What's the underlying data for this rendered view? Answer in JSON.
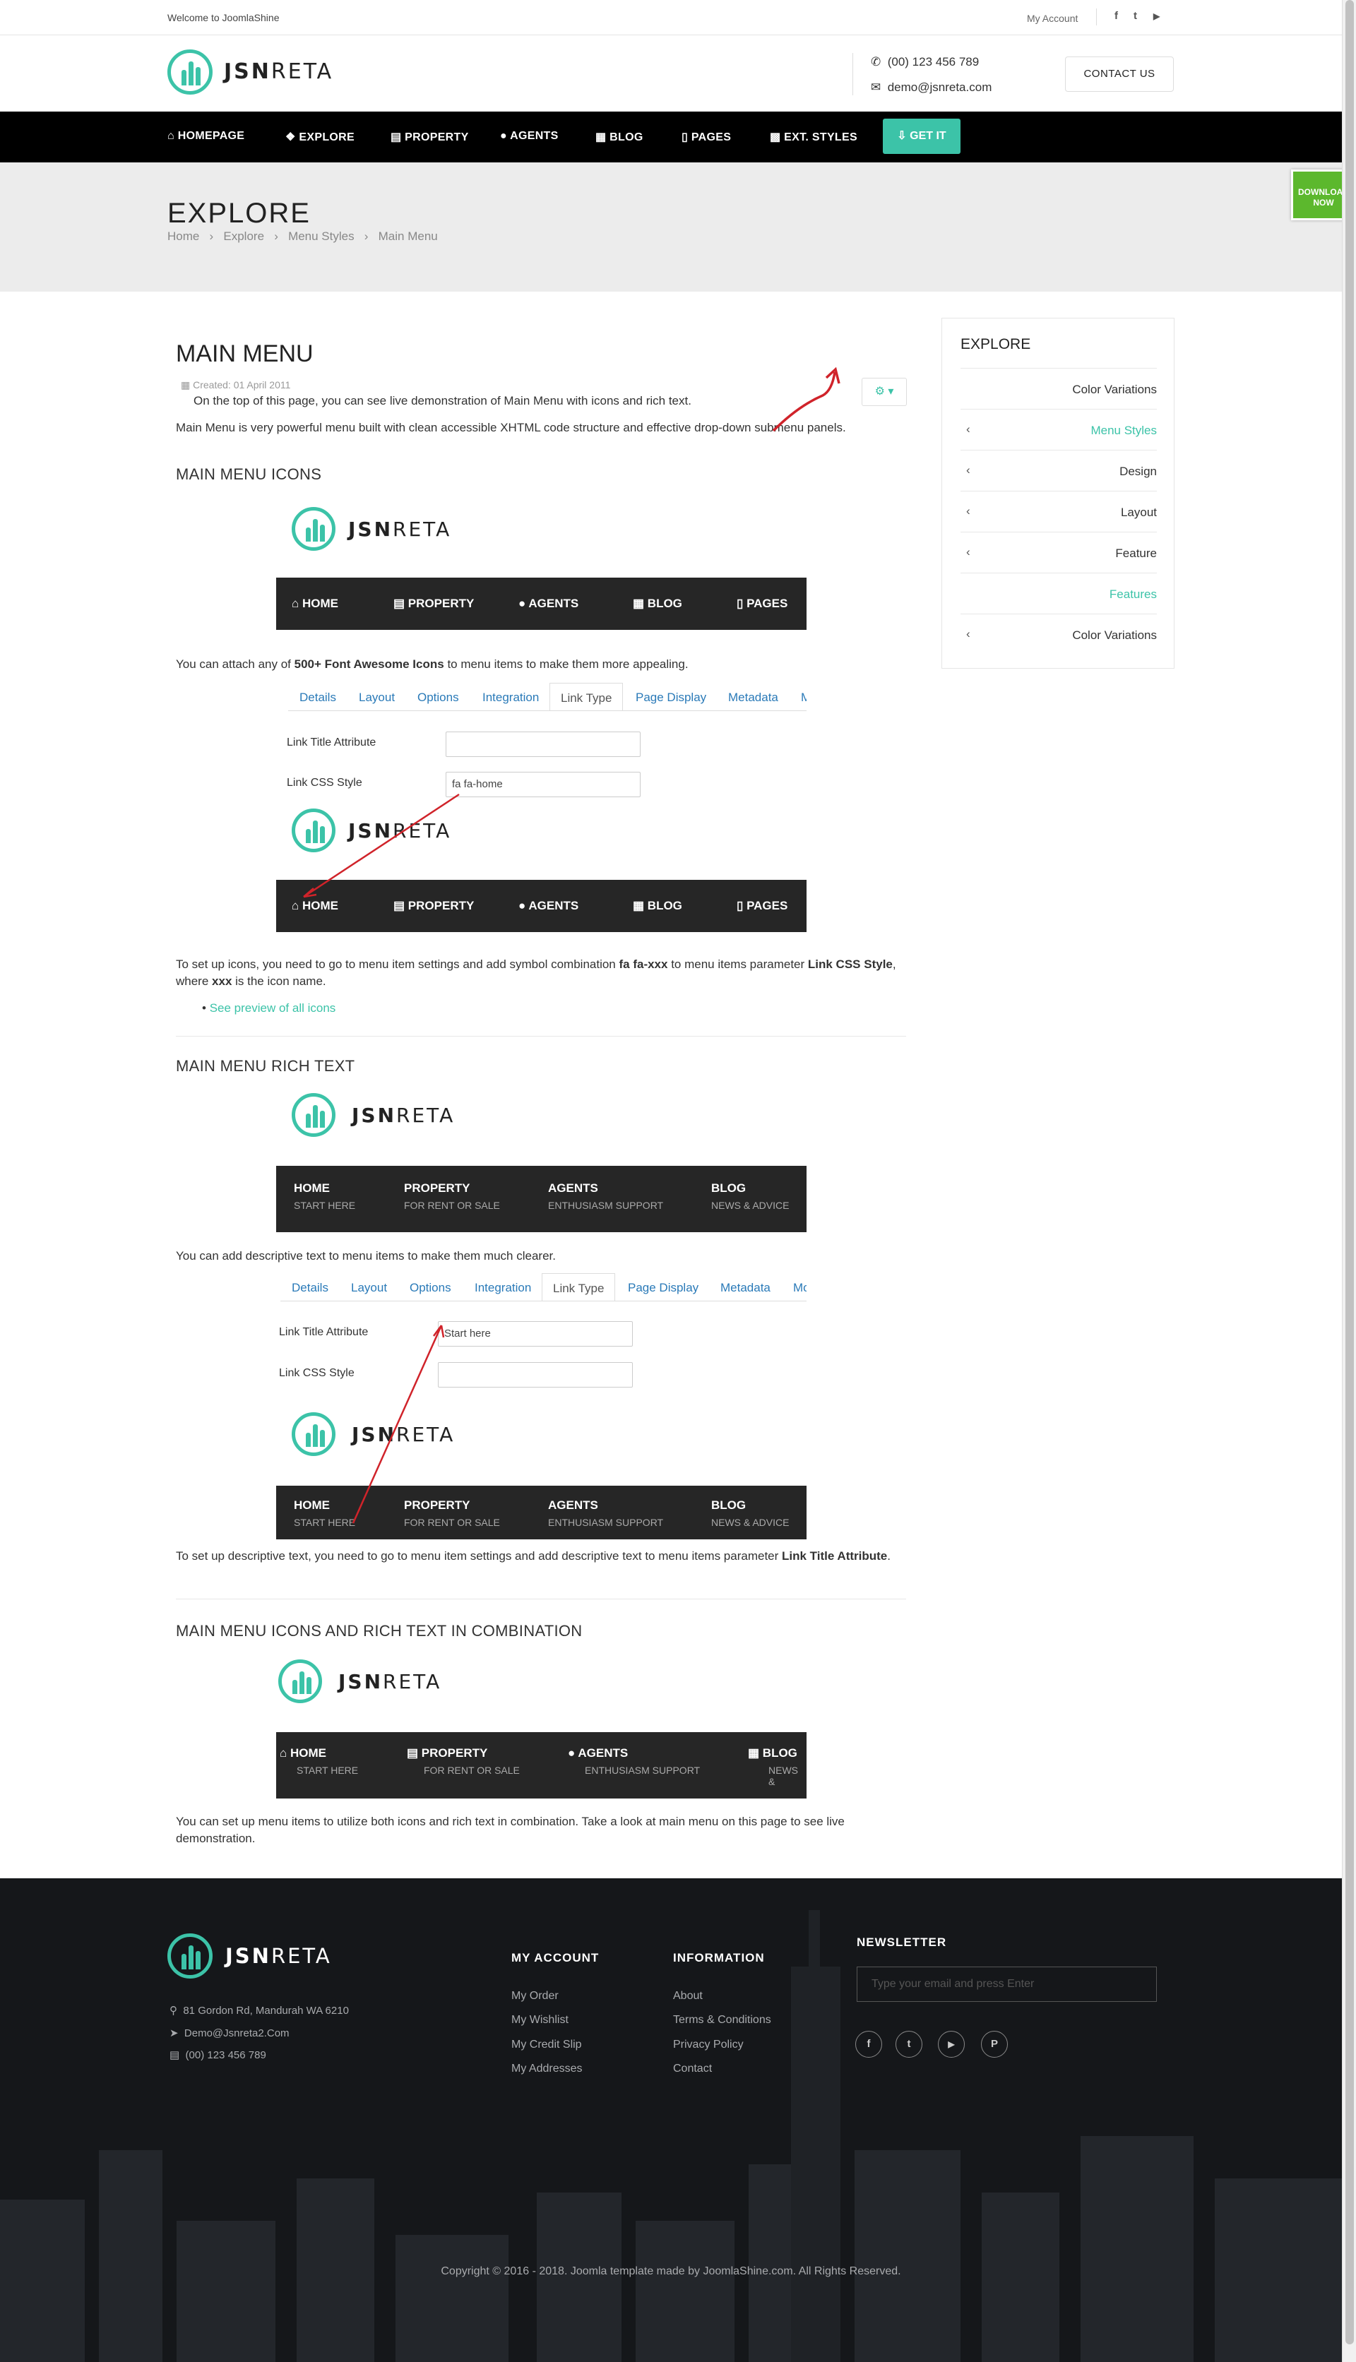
{
  "topbar": {
    "welcome": "Welcome to JoomlaShine",
    "my_account": "My Account",
    "social": [
      "f",
      "t",
      "▶"
    ]
  },
  "brand": {
    "bold": "JSN",
    "light": "RETA"
  },
  "header": {
    "phone": "(00) 123 456 789",
    "email": "demo@jsnreta.com",
    "contact_button": "CONTACT US"
  },
  "nav": {
    "items": [
      "HOMEPAGE",
      "EXPLORE",
      "PROPERTY",
      "AGENTS",
      "BLOG",
      "PAGES",
      "EXT. STYLES"
    ],
    "cta": "GET IT"
  },
  "download": {
    "line1": "DOWNLOAD",
    "line2": "NOW"
  },
  "banner": {
    "title": "EXPLORE",
    "breadcrumb": [
      "Home",
      "Explore",
      "Menu Styles",
      "Main Menu"
    ]
  },
  "article": {
    "title": "MAIN MENU",
    "created": "Created: 01 April 2011",
    "intro1": "On the top of this page, you can see live demonstration of Main Menu with icons and rich text.",
    "intro2": "Main Menu is very powerful menu built with clean accessible XHTML code structure and effective drop-down submenu panels.",
    "s1_title": "MAIN MENU ICONS",
    "s1_p1_a": "You can attach any of ",
    "s1_p1_b": "500+ Font Awesome Icons",
    "s1_p1_c": " to menu items to make them more appealing.",
    "s1_p2_a": "To set up icons, you need to go to menu item settings and add symbol combination ",
    "s1_p2_b": "fa fa-xxx",
    "s1_p2_c": " to menu items parameter ",
    "s1_p2_d": "Link CSS Style",
    "s1_p2_e": ", where ",
    "s1_p2_f": "xxx",
    "s1_p2_g": " is the icon name.",
    "s1_link": "See preview of all icons",
    "s2_title": "MAIN MENU RICH TEXT",
    "s2_p1": "You can add descriptive text to menu items to make them much clearer.",
    "s2_p2_a": "To set up descriptive text, you need to go to menu item settings and add descriptive text to menu items parameter ",
    "s2_p2_b": "Link Title Attribute",
    "s3_title": "MAIN MENU ICONS AND RICH TEXT IN COMBINATION",
    "s3_p1": "You can set up menu items to utilize both icons and rich text in combination. Take a look at main menu on this page to see live demonstration."
  },
  "demo_nav_icons": [
    "HOME",
    "PROPERTY",
    "AGENTS",
    "BLOG",
    "PAGES"
  ],
  "demo_nav_rich": [
    {
      "t": "HOME",
      "s": "START HERE"
    },
    {
      "t": "PROPERTY",
      "s": "FOR RENT OR SALE"
    },
    {
      "t": "AGENTS",
      "s": "ENTHUSIASM SUPPORT"
    },
    {
      "t": "BLOG",
      "s": "NEWS & ADVICE"
    }
  ],
  "demo_nav_combo": [
    {
      "t": "HOME",
      "s": "START HERE"
    },
    {
      "t": "PROPERTY",
      "s": "FOR RENT OR SALE"
    },
    {
      "t": "AGENTS",
      "s": "ENTHUSIASM SUPPORT"
    },
    {
      "t": "BLOG",
      "s": "NEWS &"
    }
  ],
  "editor_tabs": [
    "Details",
    "Layout",
    "Options",
    "Integration",
    "Link Type",
    "Page Display",
    "Metadata",
    "M"
  ],
  "editor_tabs2": [
    "Details",
    "Layout",
    "Options",
    "Integration",
    "Link Type",
    "Page Display",
    "Metadata",
    "Mo"
  ],
  "editor_fields": {
    "title_label": "Link Title Attribute",
    "css_label": "Link CSS Style",
    "css_value": "fa fa-home",
    "title_value": "Start here"
  },
  "sidebar": {
    "title": "EXPLORE",
    "items": [
      "Color Variations",
      "Menu Styles",
      "Design",
      "Layout",
      "Feature",
      "Features",
      "Color Variations"
    ]
  },
  "footer": {
    "address": "81 Gordon Rd, Mandurah WA 6210",
    "email": "Demo@Jsnreta2.Com",
    "phone": "(00) 123 456 789",
    "my_account_title": "MY ACCOUNT",
    "my_account": [
      "My Order",
      "My Wishlist",
      "My Credit Slip",
      "My Addresses"
    ],
    "info_title": "INFORMATION",
    "info": [
      "About",
      "Terms & Conditions",
      "Privacy Policy",
      "Contact"
    ],
    "newsletter_title": "NEWSLETTER",
    "newsletter_placeholder": "Type your email and press Enter",
    "social": [
      "f",
      "t",
      "▶",
      "P"
    ],
    "copyright": "Copyright © 2016 - 2018. Joomla template made by JoomlaShine.com. All Rights Reserved."
  },
  "colors": {
    "accent": "#3cc3a8",
    "nav_bg": "#000000",
    "download": "#5cb82d",
    "arrow": "#d0232a"
  }
}
